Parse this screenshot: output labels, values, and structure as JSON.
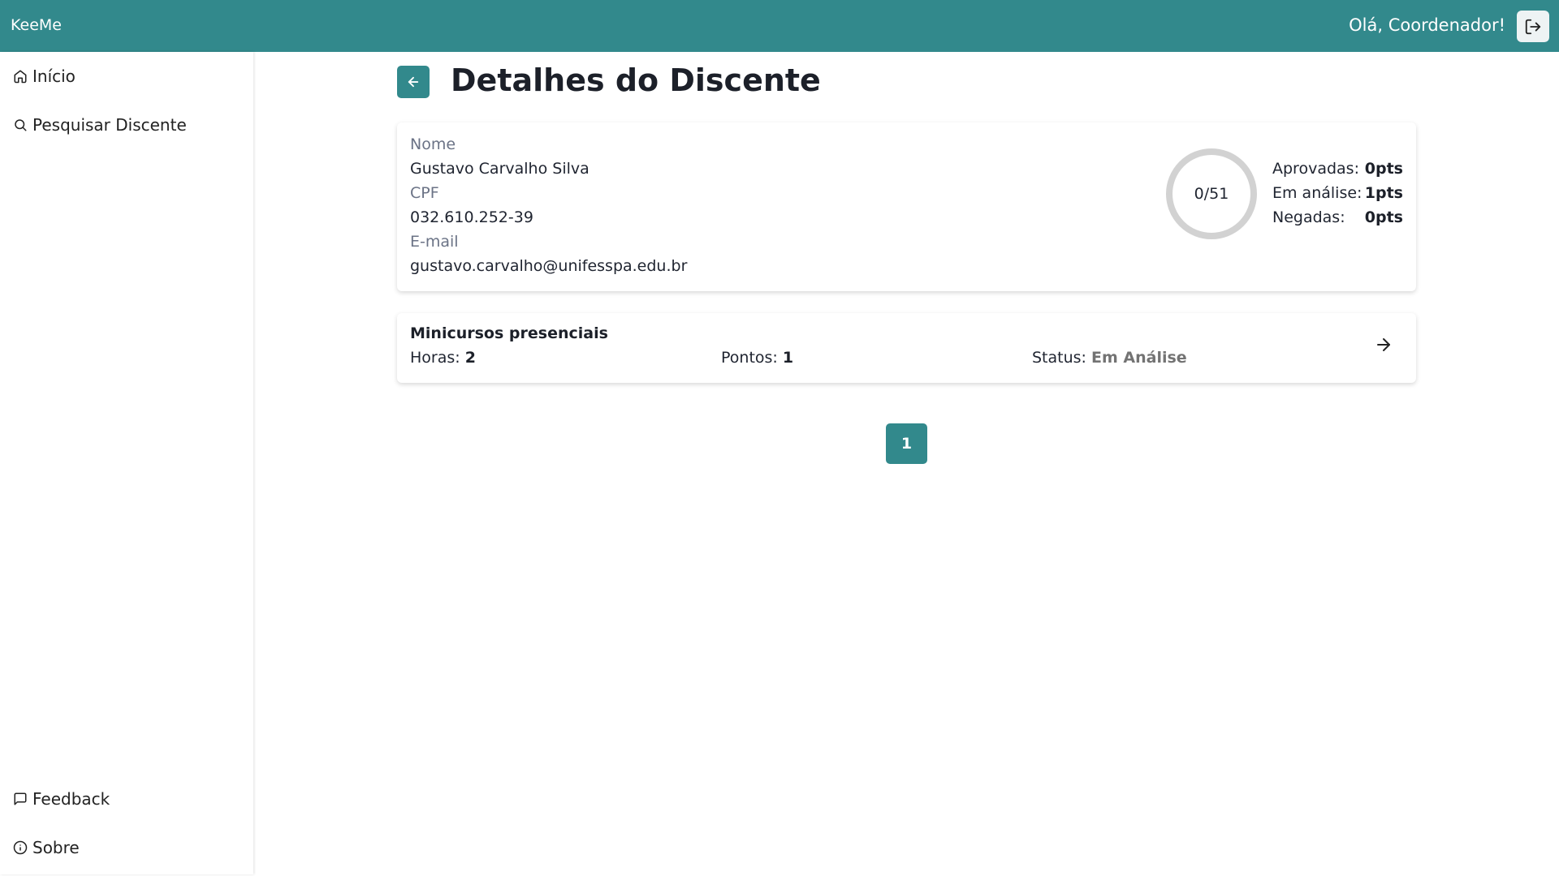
{
  "header": {
    "brand": "KeeMe",
    "greeting": "Olá, Coordenador!",
    "logout_icon": "logout-icon"
  },
  "sidebar": {
    "items": [
      {
        "label": "Início",
        "icon": "home-icon"
      },
      {
        "label": "Pesquisar Discente",
        "icon": "search-icon"
      }
    ],
    "footer_items": [
      {
        "label": "Feedback",
        "icon": "message-square-icon"
      },
      {
        "label": "Sobre",
        "icon": "info-icon"
      }
    ]
  },
  "page": {
    "title": "Detalhes do Discente",
    "back_icon": "arrow-left-icon"
  },
  "student": {
    "name_label": "Nome",
    "name": "Gustavo Carvalho Silva",
    "cpf_label": "CPF",
    "cpf": "032.610.252-39",
    "email_label": "E-mail",
    "email": "gustavo.carvalho@unifesspa.edu.br"
  },
  "progress": {
    "label": "0/51",
    "fraction": 0,
    "approved_label": "Aprovadas:",
    "approved_value": "0pts",
    "analysis_label": "Em análise:",
    "analysis_value": "1pts",
    "denied_label": "Negadas:",
    "denied_value": "0pts"
  },
  "activities": [
    {
      "title": "Minicursos presenciais",
      "hours_label": "Horas:",
      "hours": "2",
      "points_label": "Pontos:",
      "points": "1",
      "status_label": "Status:",
      "status": "Em Análise"
    }
  ],
  "pagination": {
    "current": "1"
  },
  "colors": {
    "primary": "#32898c",
    "ring_track": "#d2d2d2",
    "status_pending": "#737373"
  }
}
